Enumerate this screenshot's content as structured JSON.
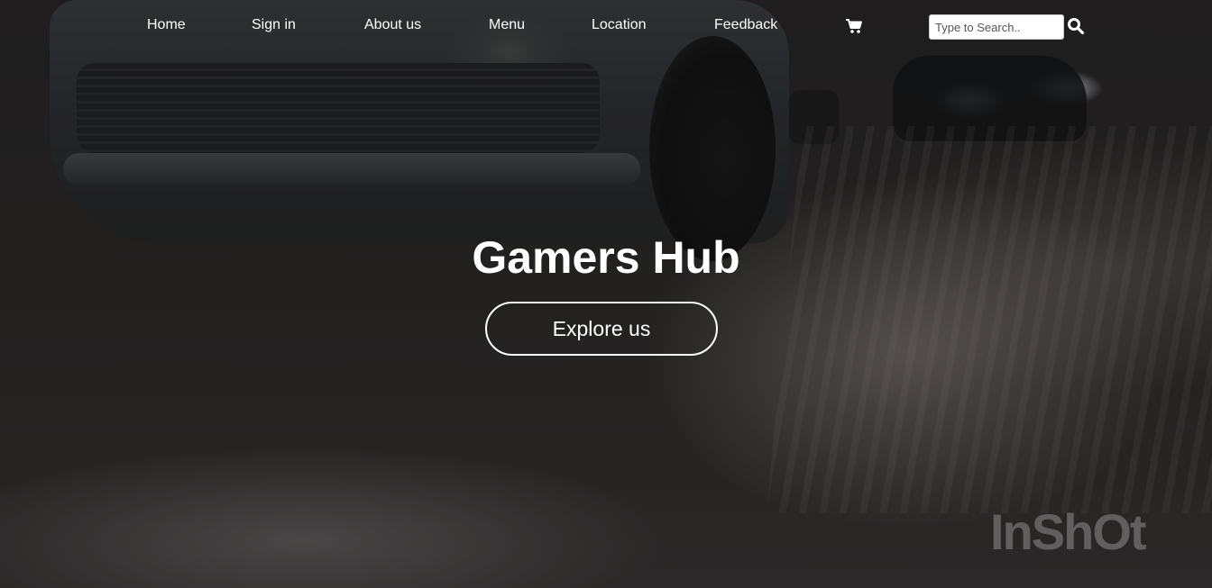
{
  "nav": {
    "links": [
      {
        "label": "Home"
      },
      {
        "label": "Sign in"
      },
      {
        "label": "About us"
      },
      {
        "label": "Menu"
      },
      {
        "label": "Location"
      },
      {
        "label": "Feedback"
      }
    ],
    "cart_icon": "shopping-cart-icon",
    "search": {
      "placeholder": "Type to Search..",
      "value": "",
      "button_icon": "search-icon"
    }
  },
  "hero": {
    "title": "Gamers Hub",
    "cta_label": "Explore us",
    "background_icon": "night-street-car-photo"
  },
  "watermark": "InShOt",
  "colors": {
    "text": "#ffffff",
    "background": "#2a2727"
  }
}
